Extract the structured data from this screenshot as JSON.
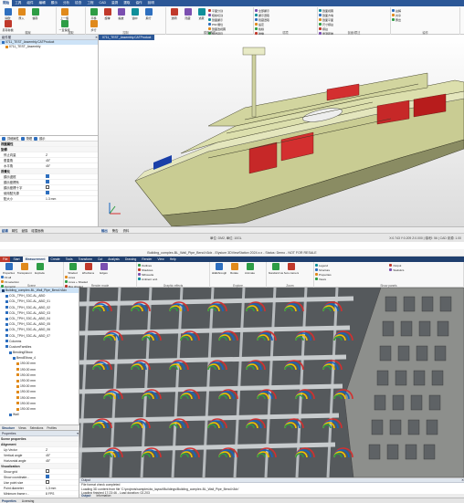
{
  "app1": {
    "menu_tabs": [
      "開始",
      "工具",
      "組件",
      "編輯",
      "顯示",
      "分析",
      "檢查",
      "工程",
      "CAD",
      "量測",
      "選取",
      "協作",
      "說明"
    ],
    "active_tab_index": 0,
    "groups": [
      {
        "label": "檔案",
        "buttons": [
          "開啟",
          "匯入",
          "儲存",
          "另存新檔"
        ]
      },
      {
        "label": "選取",
        "buttons": [
          "上一個",
          "一直保持"
        ]
      },
      {
        "label": "控制",
        "buttons": [
          "平移",
          "旋轉",
          "縮放",
          "適中",
          "飛行",
          "步行"
        ]
      },
      {
        "label": "模型格式",
        "buttons": [
          "透明",
          "隱藏",
          "遮蔽"
        ],
        "rows": [
          "平面分割",
          "框線切割",
          "剖面顯示",
          "PMI 欄位",
          "剖面透視圖",
          "預選項目"
        ]
      },
      {
        "label": "環境",
        "rows": [
          "全部顯示",
          "顯示選取",
          "隱藏選取",
          "設定",
          "格線",
          "碰撞"
        ]
      },
      {
        "label": "剖面/標註",
        "rows": [
          "剖面視圖",
          "剖面方塊",
          "剖面平面",
          "尺寸標註",
          "標註",
          "量測距離"
        ]
      },
      {
        "label": "協作",
        "rows": [
          "註解",
          "共享",
          "匯出"
        ]
      }
    ],
    "tree": {
      "title": "組件樹",
      "items": [
        "0711_TEST_Assembly.CATProduct",
        "0711_TEST_Assembly"
      ]
    },
    "viewport": {
      "tab": "0711_TEST_Assembly.CATProduct"
    },
    "properties": {
      "toolbar": [
        "詳細屬性",
        "物理",
        "顯示"
      ],
      "sections": [
        {
          "name": "視圖屬性",
          "rows": []
        },
        {
          "name": "旋轉",
          "rows": [
            {
              "k": "停止向量",
              "v": "Z"
            },
            {
              "k": "垂直角",
              "v": "45°"
            },
            {
              "k": "水平角",
              "v": "45°"
            }
          ]
        },
        {
          "name": "視覺化",
          "rows": [
            {
              "k": "顯示邊框",
              "v": "",
              "check": true
            },
            {
              "k": "顯示座標系",
              "v": "",
              "check": true
            },
            {
              "k": "顯示座標十字",
              "v": "",
              "check": false
            },
            {
              "k": "使用點光源",
              "v": "",
              "check": true
            },
            {
              "k": "點大小",
              "v": "1.3 mm"
            }
          ]
        }
      ]
    },
    "panel_tabs": [
      "結構",
      "屬性",
      "變換",
      "碰撞面積"
    ],
    "output_tabs": [
      "輸出",
      "警告",
      "資料"
    ],
    "status": {
      "left": "單位: DM2, 單位: 10GL",
      "right": "X:0.743 Y:0.209 Z:0.000 | 幀/秒: 56  | CAD 來源: 1.00"
    }
  },
  "app2": {
    "title": "Building_complex-BL_Wall_Pipe_Bend.h3dx - Elysium 3DViewStation 2024.x.x - Status: Demo - NOT FOR RESALE",
    "menu_tabs": [
      "File",
      "Start",
      "Measurement",
      "Create",
      "Tools",
      "Transform",
      "Cut",
      "Analysis",
      "Drawing",
      "Render",
      "View",
      "Help"
    ],
    "active_tab_index": 0,
    "groups": [
      {
        "label": "Scene",
        "buttons": [
          "Properties",
          "Transparent",
          "Explode"
        ],
        "rows": [
          "Fit all",
          "Fit selection",
          "Isometric"
        ]
      },
      {
        "label": "Render mode",
        "buttons": [
          "Shaded",
          "Wireframe",
          "Edges"
        ],
        "rows": [
          "Lines",
          "Lines + Shaded",
          "Box shaded"
        ]
      },
      {
        "label": "Graphic effects",
        "rows": [
          "Outlines",
          "Shadows",
          "Silhouette",
          "Ambient occl."
        ]
      },
      {
        "label": "Explore",
        "buttons": [
          "Walkthrough",
          "Rotate",
          "Animate"
        ]
      },
      {
        "label": "Zoom",
        "buttons": [
          "Standard views",
          "Auto camera"
        ]
      },
      {
        "label": "Show panels",
        "rows": [
          "Legend",
          "Structure",
          "Properties",
          "Views",
          "Output",
          "Statistics"
        ]
      }
    ],
    "tree": {
      "items": [
        "Building_complex-BL_Wall_Pipe_Bend.h3dx",
        "COL_TPIH_S3C-AL_ABO",
        "COL_TPIH_S3C-AL_ABO_01",
        "COL_TPIH_S3C-AL_ABO_02",
        "COL_TPIH_S3C-AL_ABO_03",
        "COL_TPIH_S3C-AL_ABO_04",
        "COL_TPIH_S3C-AL_ABO_05",
        "COL_TPIH_S3C-AL_ABO_06",
        "COL_TPIH_S3C-AL_ABO_07",
        "Columns",
        "CustomFamilies",
        "BendingElbow",
        "BendElbow_4",
        "190.00 mm",
        "190.00 mm",
        "190.00 mm",
        "190.00 mm",
        "190.00 mm",
        "190.00 mm",
        "190.00 mm",
        "190.00 mm",
        "190.00 mm",
        "Wall"
      ]
    },
    "panel_tabs": [
      "Structure",
      "Views",
      "Selections",
      "Profiles"
    ],
    "properties": {
      "title": "Properties",
      "sections": [
        {
          "name": "Scene properties",
          "rows": []
        },
        {
          "name": "Alignment",
          "rows": [
            {
              "k": "Up Vector",
              "v": "Z"
            },
            {
              "k": "Vertical angle",
              "v": "45°"
            },
            {
              "k": "Horizontal angle",
              "v": "45°"
            }
          ]
        },
        {
          "name": "Visualization",
          "rows": [
            {
              "k": "Show grid",
              "v": "",
              "check": false
            },
            {
              "k": "Show coordinate...",
              "v": "",
              "check": true
            },
            {
              "k": "Use point size",
              "v": "",
              "check": false
            },
            {
              "k": "Point diameter",
              "v": "1,3 mm"
            },
            {
              "k": "Minimum frame r...",
              "v": "8 FPS"
            },
            {
              "k": "Object minimum ...",
              "v": "5 %"
            },
            {
              "k": "LOD pixel size tol...",
              "v": "50 px"
            }
          ]
        },
        {
          "name": "Background",
          "rows": [
            {
              "k": "Background mo...",
              "v": "Plain"
            },
            {
              "k": "Top color",
              "v": "■ #4B4B4B"
            }
          ]
        }
      ]
    },
    "output": {
      "title": "Output",
      "lines": [
        "File format check completed",
        "Loading 3D content from file 'C:\\projects\\samples\\bc_layout\\Buildings\\Building_complex-BL_Wall_Pipe_Bend.h3dx'",
        "Loading finished 17:23:46 - Load duration: 02.203"
      ]
    },
    "bottom_tabs": [
      "Properties",
      "Licensing"
    ],
    "out_tabs": [
      "Output",
      "Information"
    ]
  },
  "colors": {
    "brand1": "#2b5797",
    "brand2": "#1f3f6e",
    "hull": "#d6d8a8",
    "pipe_red": "#d32f2f",
    "pipe_blue": "#1565c0",
    "pipe_yellow": "#f2c200",
    "pipe_green": "#2e9d45"
  }
}
